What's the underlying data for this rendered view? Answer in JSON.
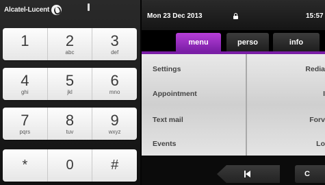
{
  "brand": {
    "name": "Alcatel-Lucent"
  },
  "keypad": {
    "rows": [
      [
        {
          "digit": "1",
          "letters": ""
        },
        {
          "digit": "2",
          "letters": "abc"
        },
        {
          "digit": "3",
          "letters": "def"
        }
      ],
      [
        {
          "digit": "4",
          "letters": "ghi"
        },
        {
          "digit": "5",
          "letters": "jkl"
        },
        {
          "digit": "6",
          "letters": "mno"
        }
      ],
      [
        {
          "digit": "7",
          "letters": "pqrs"
        },
        {
          "digit": "8",
          "letters": "tuv"
        },
        {
          "digit": "9",
          "letters": "wxyz"
        }
      ],
      [
        {
          "digit": "*",
          "letters": ""
        },
        {
          "digit": "0",
          "letters": ""
        },
        {
          "digit": "#",
          "letters": ""
        }
      ]
    ]
  },
  "status": {
    "date": "Mon 23 Dec 2013",
    "time": "15:57",
    "lock_icon": "lock-icon"
  },
  "tabs": [
    {
      "label": "menu",
      "active": true
    },
    {
      "label": "perso",
      "active": false
    },
    {
      "label": "info",
      "active": false
    }
  ],
  "menu": {
    "left": [
      "Settings",
      "Appointment",
      "Text mail",
      "Events"
    ],
    "right": [
      "Redia",
      "I",
      "Forv",
      "Lo"
    ]
  },
  "bottom": {
    "back_icon": "skip-back-icon",
    "right_label": "C"
  },
  "colors": {
    "accent": "#7a1ea6",
    "accent_light": "#b63ed8"
  }
}
